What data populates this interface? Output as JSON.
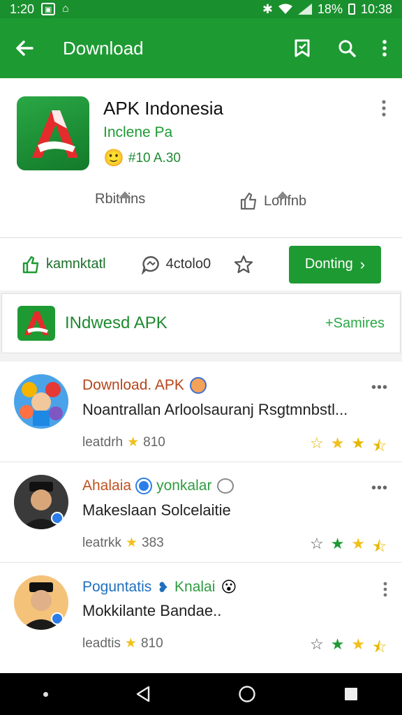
{
  "status": {
    "time_left": "1:20",
    "battery": "18%",
    "time_right": "10:38"
  },
  "appbar": {
    "title": "Download"
  },
  "app": {
    "name": "APK Indonesia",
    "developer": "Inclene Pa",
    "rating_text": "#10 A.30"
  },
  "stats": {
    "left": "Rbitnins",
    "right": "Lorifnb"
  },
  "actions": {
    "a1": "kamnktatl",
    "a2": "4ctolo0",
    "primary": "Donting"
  },
  "section": {
    "title": "INdwesd APK",
    "link": "+Samires"
  },
  "items": [
    {
      "title": "Download. APK",
      "title2": "",
      "subtitle": "Noantrallan Arloolsauranj Rsgtmnbstl...",
      "meta_label": "leatdrh",
      "meta_value": "810",
      "title_color": "#b5451b"
    },
    {
      "title": "Ahalaia",
      "title2": "yonkalar",
      "subtitle": "Makeslaan Solcelaitie",
      "meta_label": "leatrkk",
      "meta_value": "383",
      "title_color": "#c0501f"
    },
    {
      "title": "Poguntatis",
      "title2": "Knalai",
      "subtitle": "Mokkilante Bandae..",
      "meta_label": "leadtis",
      "meta_value": "810",
      "title_color": "#1f6fc0"
    }
  ],
  "colors": {
    "primary": "#1e9a33",
    "status_bar": "#1a8f2e",
    "star": "#f2c01c",
    "star_green": "#1e9a33"
  }
}
